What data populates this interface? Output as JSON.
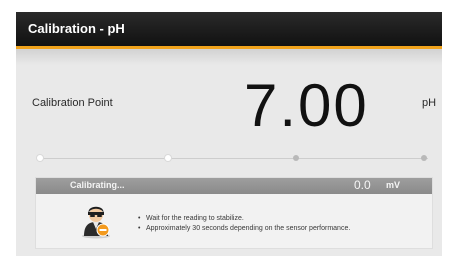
{
  "window": {
    "title": "Calibration - pH",
    "accent_color": "#f0a21b"
  },
  "calibration": {
    "point_label": "Calibration Point",
    "value": "7.00",
    "unit": "pH",
    "steps_total": 4,
    "steps_active": 2
  },
  "status": {
    "text": "Calibrating...",
    "reading": "0.0",
    "reading_unit": "mV",
    "icon": "technician-busy-icon",
    "instructions": [
      "Wait for the reading to stabilize.",
      "Approximately 30 seconds depending on the sensor performance."
    ]
  }
}
